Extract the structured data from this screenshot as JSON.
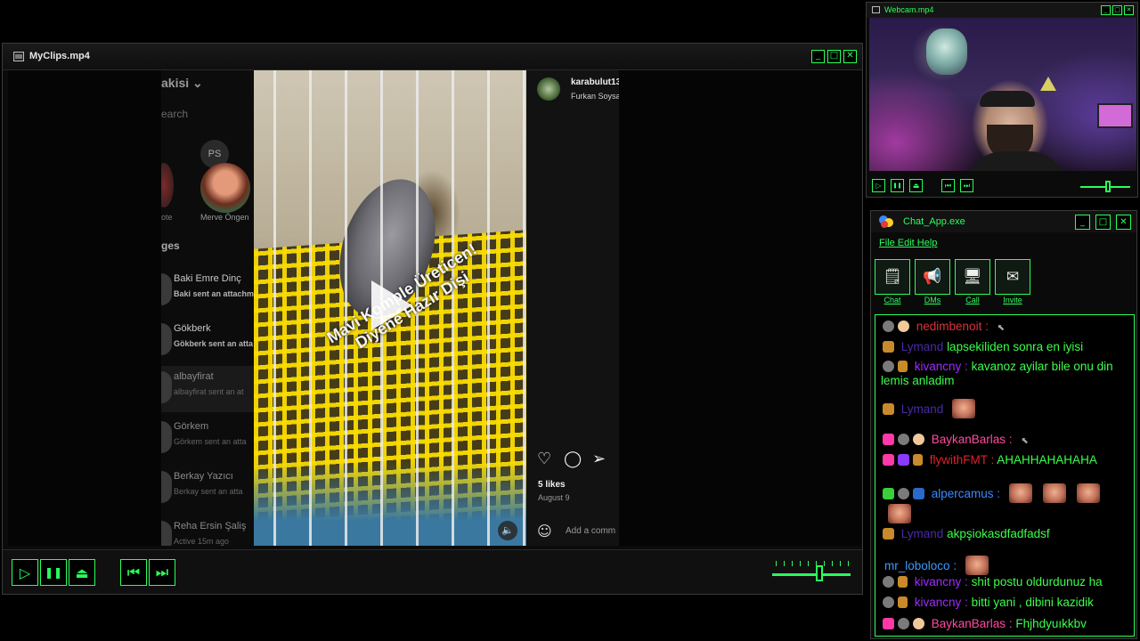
{
  "player": {
    "title": "MyClips.mp4",
    "window_buttons": [
      "_",
      "□",
      "✕"
    ],
    "controls": {
      "play": "▷",
      "pause": "❚❚",
      "eject": "⏏",
      "prev": "⏮",
      "next": "⏭"
    },
    "volume_level": 0.6
  },
  "instagram": {
    "dm": {
      "account": "akisi",
      "search_placeholder": "earch",
      "notes": [
        {
          "label": "ote"
        },
        {
          "initials": "PS",
          "label": "Merve Öngen"
        }
      ],
      "section_header": "ges",
      "threads": [
        {
          "name": "Baki Emre Dinç",
          "sub": "Baki sent an attachm"
        },
        {
          "name": "Gökberk",
          "sub": "Gökberk sent an atta"
        },
        {
          "name": "albayfirat",
          "sub": "albayfirat sent an at"
        },
        {
          "name": "Görkem",
          "sub": "Görkem sent an atta"
        },
        {
          "name": "Berkay Yazıcı",
          "sub": "Berkay sent an atta"
        },
        {
          "name": "Reha Ersin Şaliş",
          "sub": "Active 15m ago"
        }
      ]
    },
    "reel": {
      "caption_line1": "Mavi Komple Üreticen!",
      "caption_line2": "Diyene Hazır Dişi"
    },
    "post": {
      "username": "karabulut13",
      "subtitle": "Furkan Soysa",
      "likes": "5 likes",
      "date": "August 9",
      "comment_placeholder": "Add a comm"
    }
  },
  "webcam": {
    "title": "Webcam.mp4",
    "volume_level": 0.55
  },
  "chat": {
    "title": "Chat_App.exe",
    "menu": "File Edit Help",
    "tools": [
      {
        "label": "Chat",
        "icon": "chat-icon"
      },
      {
        "label": "DMs",
        "icon": "megaphone-icon"
      },
      {
        "label": "Call",
        "icon": "monitor-icon"
      },
      {
        "label": "Invite",
        "icon": "envelope-icon"
      }
    ],
    "messages": [
      {
        "user": "nedimbenoit",
        "color": "#e0303a",
        "text": ""
      },
      {
        "user": "Lymand",
        "color": "#4a2aa8",
        "text": "lapsekiliden sonra en iyisi"
      },
      {
        "user": "kivancny",
        "color": "#a02aff",
        "text": "kavanoz ayilar bile onu din"
      },
      {
        "user": "",
        "color": "#3aff4a",
        "text": "lemis anladim"
      },
      {
        "user": "Lymand",
        "color": "#4a2aa8",
        "text": ""
      },
      {
        "user": "BaykanBarlas",
        "color": "#ff4aa0",
        "text": ""
      },
      {
        "user": "flywithFMT",
        "color": "#e0202a",
        "text": "AHAHHAHAHAHA"
      },
      {
        "user": "alpercamus",
        "color": "#3a8aff",
        "text": ""
      },
      {
        "user": "Lymand",
        "color": "#4a2aa8",
        "text": "akpşiokasdfadfadsf"
      },
      {
        "user": "mr_loboloco",
        "color": "#3a9aff",
        "text": ""
      },
      {
        "user": "kivancny",
        "color": "#a02aff",
        "text": "shit postu oldurdunuz ha"
      },
      {
        "user": "kivancny",
        "color": "#a02aff",
        "text": "bitti yani , dibini kazidik"
      },
      {
        "user": "BaykanBarlas",
        "color": "#ff4aa0",
        "text": "Fhjhdyuıkkbv"
      }
    ],
    "separator": " : "
  },
  "colors": {
    "accent": "#2aff5a",
    "chat_text": "#3aff4a"
  }
}
